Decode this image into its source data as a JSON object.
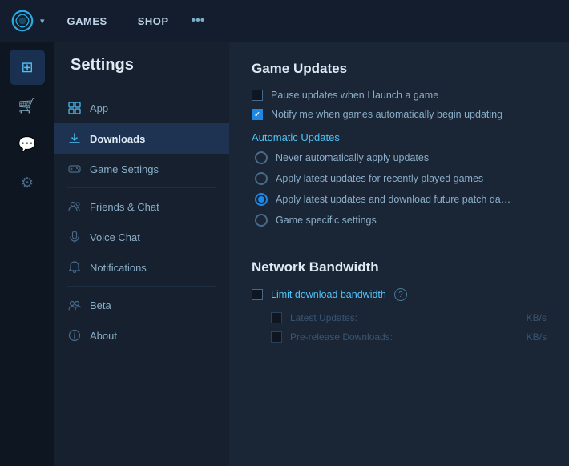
{
  "topnav": {
    "logo_alt": "Battle.net logo",
    "items": [
      {
        "label": "GAMES",
        "active": false
      },
      {
        "label": "SHOP",
        "active": false
      }
    ],
    "more_label": "•••"
  },
  "settings": {
    "title": "Settings",
    "nav_items": [
      {
        "id": "app",
        "label": "App",
        "icon": "⊞"
      },
      {
        "id": "downloads",
        "label": "Downloads",
        "icon": "⬇",
        "active": true
      },
      {
        "id": "game-settings",
        "label": "Game Settings",
        "icon": "🎮"
      },
      {
        "id": "friends-chat",
        "label": "Friends & Chat",
        "icon": "👤"
      },
      {
        "id": "voice-chat",
        "label": "Voice Chat",
        "icon": "🎤"
      },
      {
        "id": "notifications",
        "label": "Notifications",
        "icon": "🔔"
      },
      {
        "id": "beta",
        "label": "Beta",
        "icon": "👥"
      },
      {
        "id": "about",
        "label": "About",
        "icon": "ℹ"
      }
    ]
  },
  "content": {
    "section1_title": "Game Updates",
    "checkbox1_label": "Pause updates when I launch a game",
    "checkbox1_checked": false,
    "checkbox2_label": "Notify me when games automatically begin updating",
    "checkbox2_checked": true,
    "auto_updates_label": "Automatic Updates",
    "radio_options": [
      {
        "id": "never",
        "label": "Never automatically apply updates",
        "selected": false
      },
      {
        "id": "recently-played",
        "label": "Apply latest updates for recently played games",
        "selected": false
      },
      {
        "id": "apply-future",
        "label": "Apply latest updates and download future patch da…",
        "selected": true
      },
      {
        "id": "game-specific",
        "label": "Game specific settings",
        "selected": false
      }
    ],
    "section2_title": "Network Bandwidth",
    "bandwidth_label": "Limit download bandwidth",
    "bandwidth_checked": false,
    "latest_updates_label": "Latest Updates:",
    "latest_updates_unit": "KB/s",
    "prerelease_label": "Pre-release Downloads:",
    "prerelease_unit": "KB/s"
  },
  "icon_sidebar": {
    "items": [
      {
        "id": "grid",
        "icon": "⊞",
        "active": true
      },
      {
        "id": "cart",
        "icon": "🛒",
        "active": false
      },
      {
        "id": "chat",
        "icon": "💬",
        "active": false
      },
      {
        "id": "gear",
        "icon": "⚙",
        "active": false
      }
    ]
  }
}
